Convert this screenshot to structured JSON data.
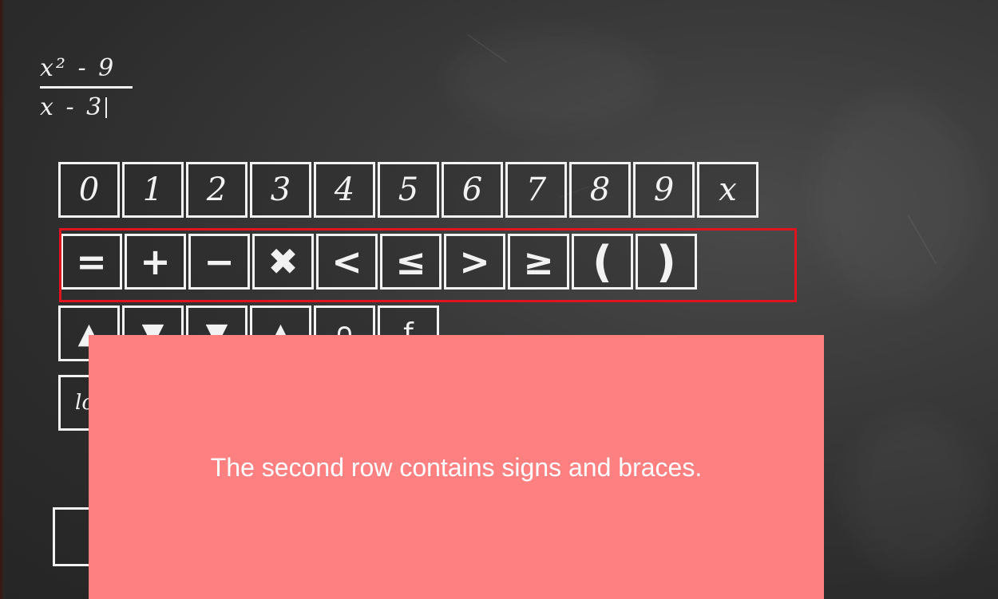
{
  "expression": {
    "numerator": "x² - 9",
    "denominator": "x - 3"
  },
  "keypad": {
    "digits_row": [
      "0",
      "1",
      "2",
      "3",
      "4",
      "5",
      "6",
      "7",
      "8",
      "9",
      "x"
    ],
    "signs_row": [
      "=",
      "+",
      "−",
      "✖",
      "<",
      "≤",
      ">",
      "≥",
      "(",
      ")"
    ],
    "function_row": [
      "▲",
      "▼",
      "▼",
      "▲",
      "∩",
      "f"
    ],
    "log_row": [
      "lo"
    ]
  },
  "callout": {
    "text": "The second row contains signs and braces.",
    "background_color": "#ff8080"
  },
  "highlight": {
    "color": "#e0141e"
  }
}
